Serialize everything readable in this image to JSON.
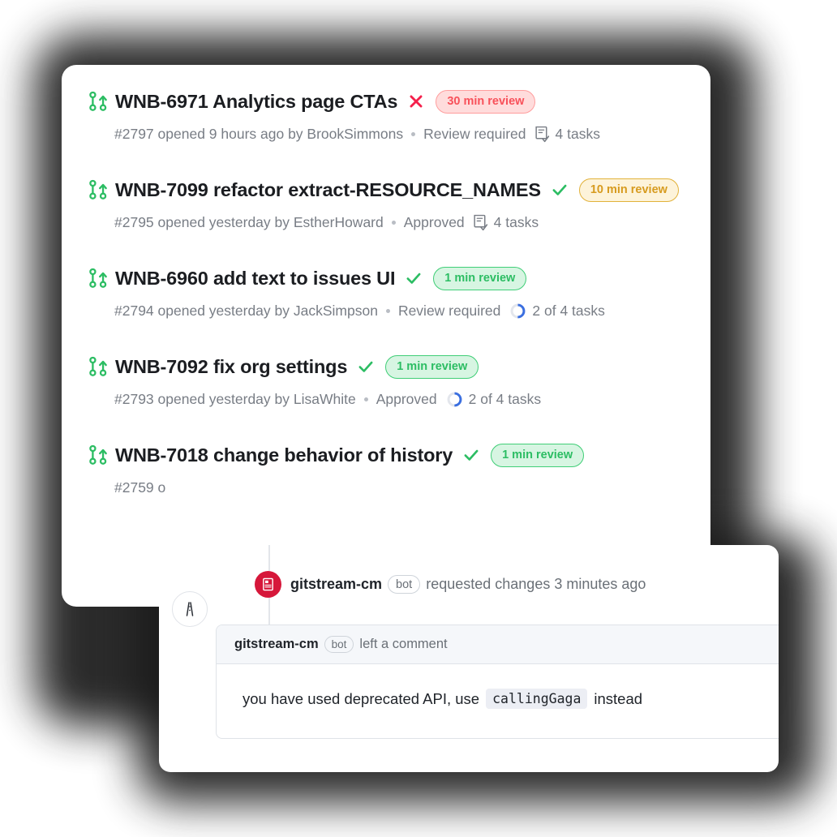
{
  "pull_requests": [
    {
      "icon": "pull-request-icon",
      "title": "WNB-6971 Analytics page CTAs",
      "status_icon": "x-mark-icon",
      "badge": {
        "label": "30 min review",
        "tone": "red",
        "color": "#f8515a"
      },
      "number": "#2797",
      "meta": "#2797 opened 9 hours ago by BrookSimmons",
      "review_state": "Review required",
      "tasks_icon": "tasklist-icon",
      "tasks": "4 tasks",
      "progress": null
    },
    {
      "icon": "pull-request-icon",
      "title": "WNB-7099 refactor extract-RESOURCE_NAMES",
      "status_icon": "check-mark-icon",
      "badge": {
        "label": "10 min review",
        "tone": "amber",
        "color": "#d79b1f"
      },
      "number": "#2795",
      "meta": "#2795 opened yesterday by  EstherHoward",
      "review_state": "Approved",
      "tasks_icon": "tasklist-icon",
      "tasks": "4 tasks",
      "progress": null
    },
    {
      "icon": "pull-request-icon",
      "title": "WNB-6960 add text to issues UI",
      "status_icon": "check-mark-icon",
      "badge": {
        "label": "1 min review",
        "tone": "green",
        "color": "#2cbd63"
      },
      "number": "#2794",
      "meta": "#2794 opened yesterday by JackSimpson",
      "review_state": "Review required",
      "tasks_icon": "progress-ring-icon",
      "tasks": "2 of 4 tasks",
      "progress": 50
    },
    {
      "icon": "pull-request-icon",
      "title": "WNB-7092 fix org settings",
      "status_icon": "check-mark-icon",
      "badge": {
        "label": "1 min review",
        "tone": "green",
        "color": "#2cbd63"
      },
      "number": "#2793",
      "meta": "#2793 opened yesterday by LisaWhite",
      "review_state": "Approved",
      "tasks_icon": "progress-ring-icon",
      "tasks": "2 of 4 tasks",
      "progress": 50
    },
    {
      "icon": "pull-request-icon",
      "title": "WNB-7018 change behavior of history",
      "status_icon": "check-mark-icon",
      "badge": {
        "label": "1 min review",
        "tone": "green",
        "color": "#2cbd63"
      },
      "number": "#2759",
      "meta": "#2759 o",
      "review_state": "",
      "tasks_icon": "",
      "tasks": "",
      "progress": null
    }
  ],
  "comment_card": {
    "avatar_icon": "road-logo-avatar",
    "event": {
      "badge_icon": "requested-changes-icon",
      "badge_color": "#d6173a",
      "user": "gitstream-cm",
      "bot_label": "bot",
      "action": "requested changes 3 minutes ago"
    },
    "comment_box": {
      "header": {
        "user": "gitstream-cm",
        "bot_label": "bot",
        "action": "left a comment"
      },
      "body": {
        "text_before": "you have used deprecated API, use",
        "code": "callingGaga",
        "text_after": "instead"
      }
    }
  }
}
